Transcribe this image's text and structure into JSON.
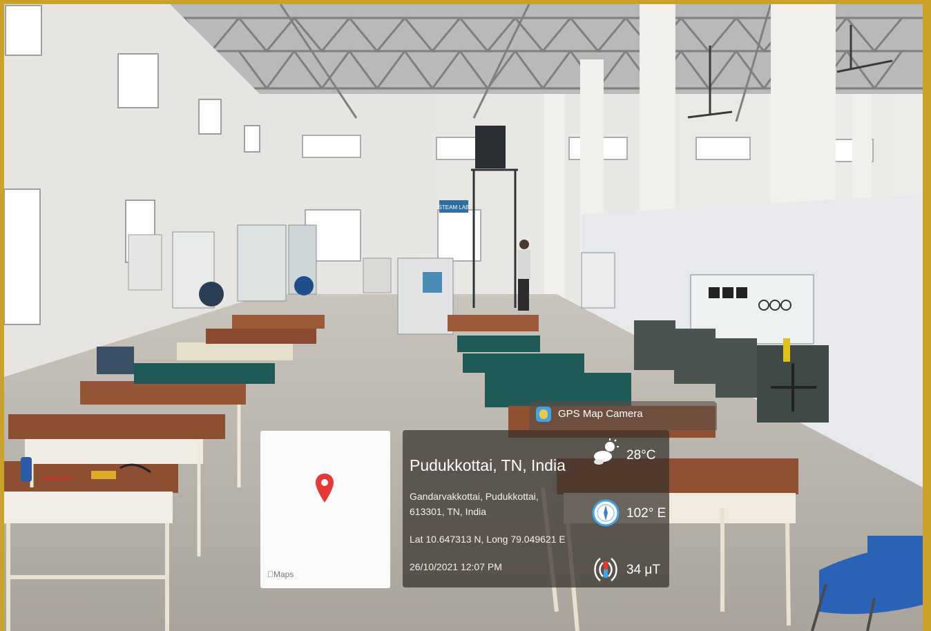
{
  "gps_overlay": {
    "app_name": "GPS Map Camera",
    "map_provider": "Maps",
    "location_title": "Pudukkottai, TN, India",
    "address_line1": "Gandarvakkottai, Pudukkottai,",
    "address_line2": "613301, TN, India",
    "coordinates": "Lat 10.647313 N, Long 79.049621 E",
    "datetime": "26/10/2021 12:07 PM",
    "temperature": "28°C",
    "compass": "102° E",
    "magnetic_field": "34 μT"
  },
  "signs": {
    "steam_lab": "STEAM LAB"
  },
  "icons": {
    "map_pin": "location-pin-icon",
    "weather": "cloud-sun-icon",
    "compass": "compass-icon",
    "magnet": "magnetic-field-icon",
    "app": "gps-camera-app-icon"
  },
  "colors": {
    "frame_border": "#c9a227",
    "pin": "#e53935",
    "accent_blue": "#3da6e8"
  }
}
